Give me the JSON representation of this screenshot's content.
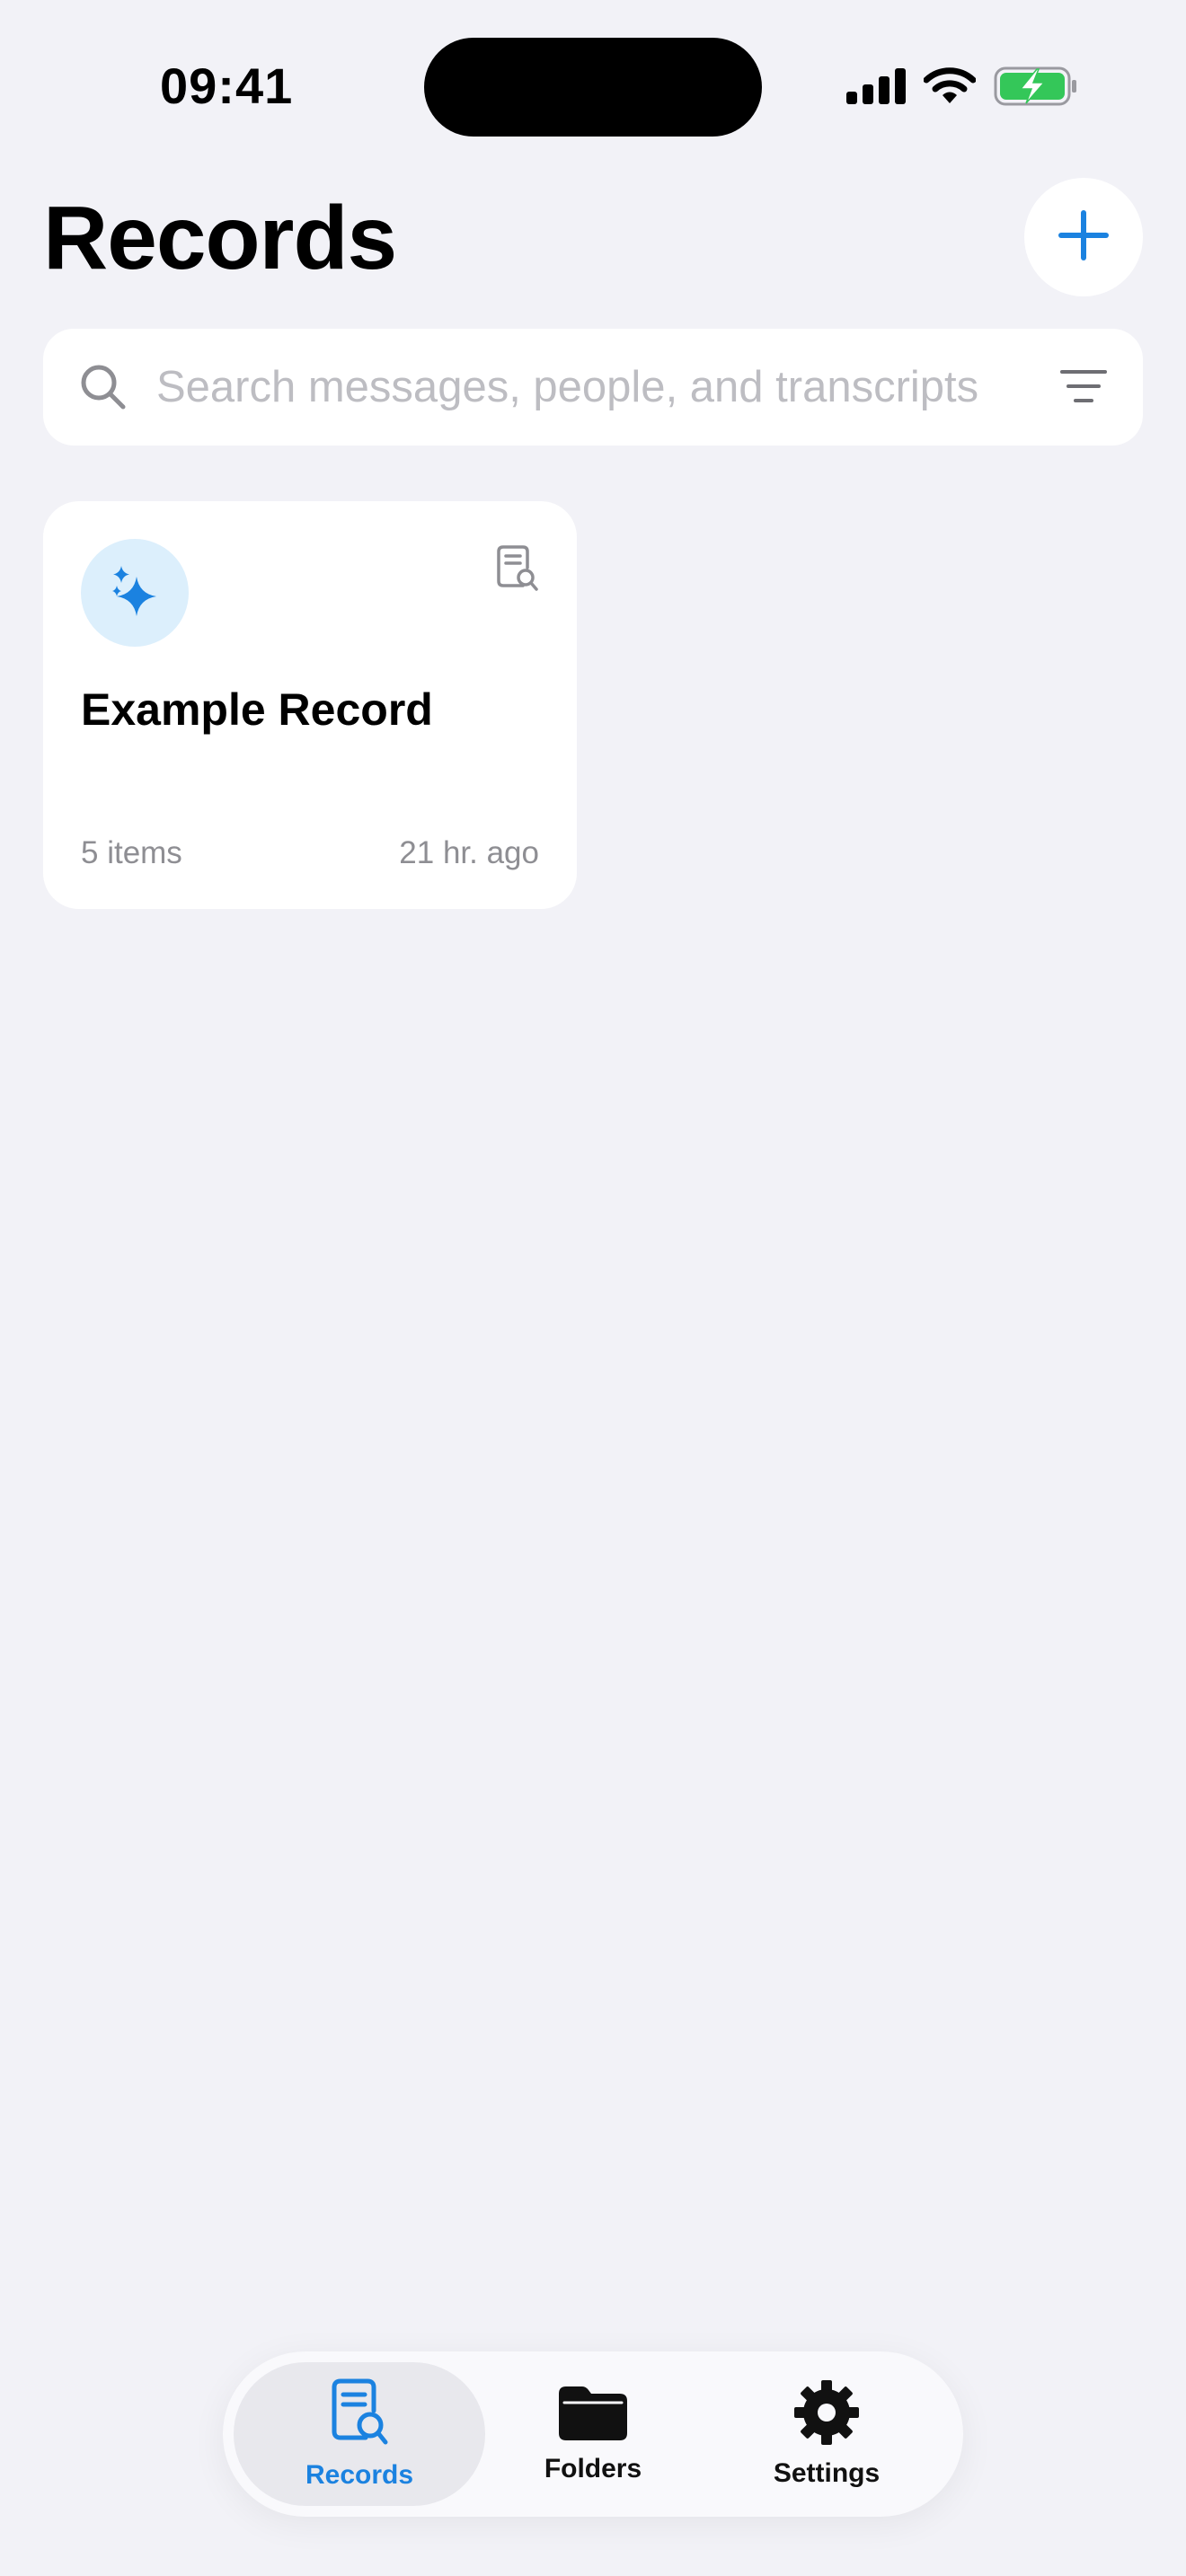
{
  "status_bar": {
    "time": "09:41"
  },
  "header": {
    "title": "Records",
    "add_icon": "plus-icon"
  },
  "search": {
    "placeholder": "Search messages, people, and transcripts",
    "value": ""
  },
  "records": [
    {
      "title": "Example Record",
      "count": "5 items",
      "time": "21 hr. ago",
      "badge_icon": "sparkles-icon",
      "type_icon": "document-search-icon"
    }
  ],
  "tab_bar": {
    "tabs": [
      {
        "label": "Records",
        "icon": "document-search-icon",
        "active": true
      },
      {
        "label": "Folders",
        "icon": "folder-icon",
        "active": false
      },
      {
        "label": "Settings",
        "icon": "gear-icon",
        "active": false
      }
    ]
  },
  "colors": {
    "accent": "#1B82E0",
    "background": "#F2F2F7",
    "card": "#FFFFFF",
    "secondary_text": "#8E8E93",
    "battery": "#34C759"
  }
}
